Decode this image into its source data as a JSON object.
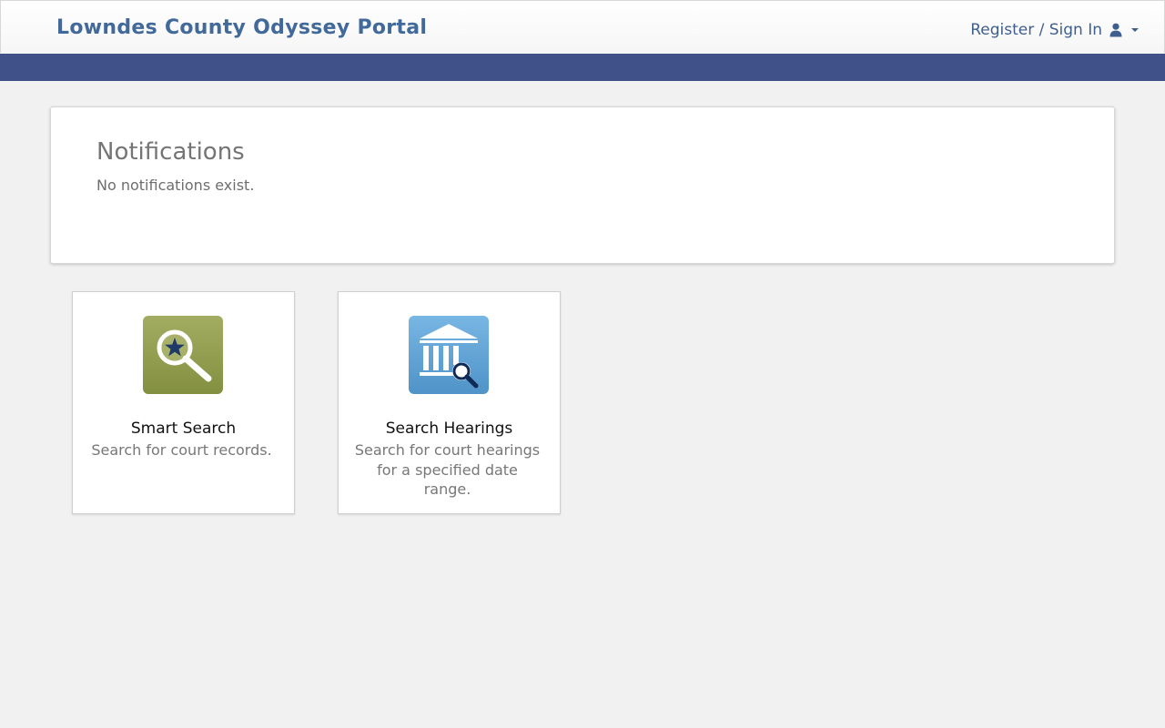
{
  "header": {
    "title": "Lowndes County Odyssey Portal",
    "signin_label": "Register / Sign In",
    "user_icon": "user-icon",
    "caret_icon": "caret-down-icon",
    "title_color": "#41699a",
    "band_color": "#405189"
  },
  "notifications": {
    "heading": "Notifications",
    "message": "No notifications exist."
  },
  "tiles": [
    {
      "title": "Smart Search",
      "description": "Search for court records.",
      "icon": "magnifier-star-icon",
      "icon_color": "#8f9b4d"
    },
    {
      "title": "Search Hearings",
      "description": "Search for court hearings for a specified date range.",
      "icon": "courthouse-search-icon",
      "icon_color": "#5b9fd3"
    }
  ]
}
